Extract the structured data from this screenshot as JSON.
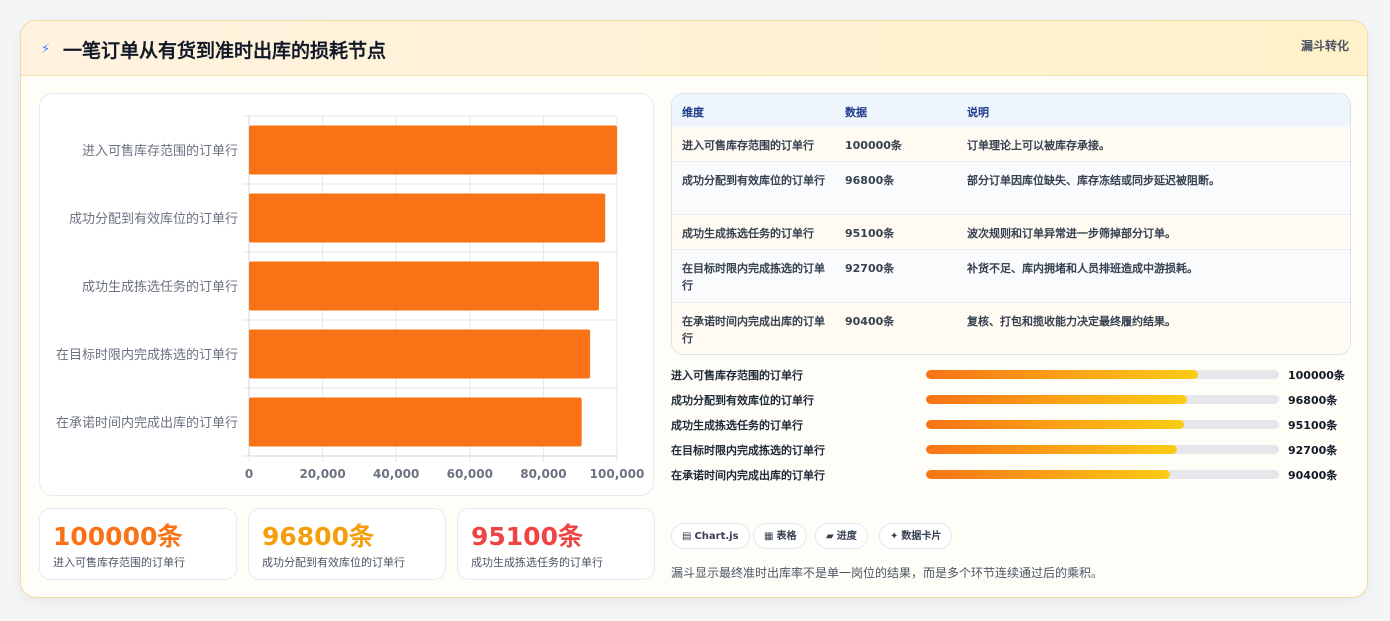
{
  "header": {
    "title": "一笔订单从有货到准时出库的损耗节点",
    "tag": "漏斗转化",
    "icon": "lightning-icon"
  },
  "colors": {
    "bar": "#f97316",
    "stat1": "#f97316",
    "stat2": "#f59e0b",
    "stat3": "#ef4444",
    "progress_start": "#f97316",
    "progress_end": "#facc15"
  },
  "chart_data": {
    "type": "bar",
    "orientation": "horizontal",
    "categories": [
      "进入可售库存范围的订单行",
      "成功分配到有效库位的订单行",
      "成功生成拣选任务的订单行",
      "在目标时限内完成拣选的订单行",
      "在承诺时间内完成出库的订单行"
    ],
    "values": [
      100000,
      96800,
      95100,
      92700,
      90400
    ],
    "xlim": [
      0,
      100000
    ],
    "xticks": [
      "0",
      "20,000",
      "40,000",
      "60,000",
      "80,000",
      "100,000"
    ],
    "grid": true
  },
  "stats": [
    {
      "value": "100000条",
      "label": "进入可售库存范围的订单行"
    },
    {
      "value": "96800条",
      "label": "成功分配到有效库位的订单行"
    },
    {
      "value": "95100条",
      "label": "成功生成拣选任务的订单行"
    }
  ],
  "table": {
    "headers": [
      "维度",
      "数据",
      "说明"
    ],
    "rows": [
      {
        "dim": "进入可售库存范围的订单行",
        "data": "100000条",
        "desc": "订单理论上可以被库存承接。"
      },
      {
        "dim": "成功分配到有效库位的订单行",
        "data": "96800条",
        "desc": "部分订单因库位缺失、库存冻结或同步延迟被阻断。"
      },
      {
        "dim": "成功生成拣选任务的订单行",
        "data": "95100条",
        "desc": "波次规则和订单异常进一步筛掉部分订单。"
      },
      {
        "dim": "在目标时限内完成拣选的订单行",
        "data": "92700条",
        "desc": "补货不足、库内拥堵和人员排班造成中游损耗。"
      },
      {
        "dim": "在承诺时间内完成出库的订单行",
        "data": "90400条",
        "desc": "复核、打包和揽收能力决定最终履约结果。"
      }
    ]
  },
  "progress": [
    {
      "label": "进入可售库存范围的订单行",
      "value": "100000条",
      "fraction": 0.77
    },
    {
      "label": "成功分配到有效库位的订单行",
      "value": "96800条",
      "fraction": 0.74
    },
    {
      "label": "成功生成拣选任务的订单行",
      "value": "95100条",
      "fraction": 0.73
    },
    {
      "label": "在目标时限内完成拣选的订单行",
      "value": "92700条",
      "fraction": 0.71
    },
    {
      "label": "在承诺时间内完成出库的订单行",
      "value": "90400条",
      "fraction": 0.69
    }
  ],
  "chips": [
    {
      "label": "Chart.js",
      "icon": "chart-icon",
      "glyph": "▤"
    },
    {
      "label": "表格",
      "icon": "table-icon",
      "glyph": "▦"
    },
    {
      "label": "进度",
      "icon": "progress-icon",
      "glyph": "▰"
    },
    {
      "label": "数据卡片",
      "icon": "card-icon",
      "glyph": "✦"
    }
  ],
  "note": "漏斗显示最终准时出库率不是单一岗位的结果，而是多个环节连续通过后的乘积。"
}
